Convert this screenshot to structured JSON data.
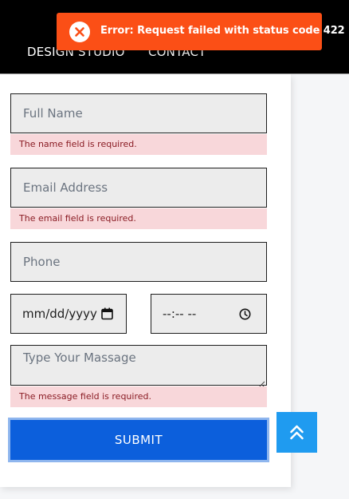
{
  "nav": {
    "items": [
      "DESIGN STUDIO",
      "CONTACT"
    ]
  },
  "toast": {
    "icon": "error-circle-x-icon",
    "message": "Error: Request failed with status code 422",
    "color": "#fb4f16"
  },
  "form": {
    "name": {
      "placeholder": "Full Name",
      "error": "The name field is required."
    },
    "email": {
      "placeholder": "Email Address",
      "error": "The email field is required."
    },
    "phone": {
      "placeholder": "Phone"
    },
    "date": {
      "value": "mm/dd/yyyy",
      "icon": "calendar-icon"
    },
    "time": {
      "value": "--:-- --",
      "icon": "clock-icon"
    },
    "message": {
      "placeholder": "Type Your Massage",
      "error": "The message field is required."
    },
    "submit_label": "SUBMIT"
  },
  "scroll_top": {
    "icon": "double-chevron-up-icon"
  },
  "colors": {
    "error_bg": "#f8d7da",
    "error_text": "#8a1c24",
    "submit": "#0c5fdc",
    "scroll_top": "#1f9bf0"
  }
}
